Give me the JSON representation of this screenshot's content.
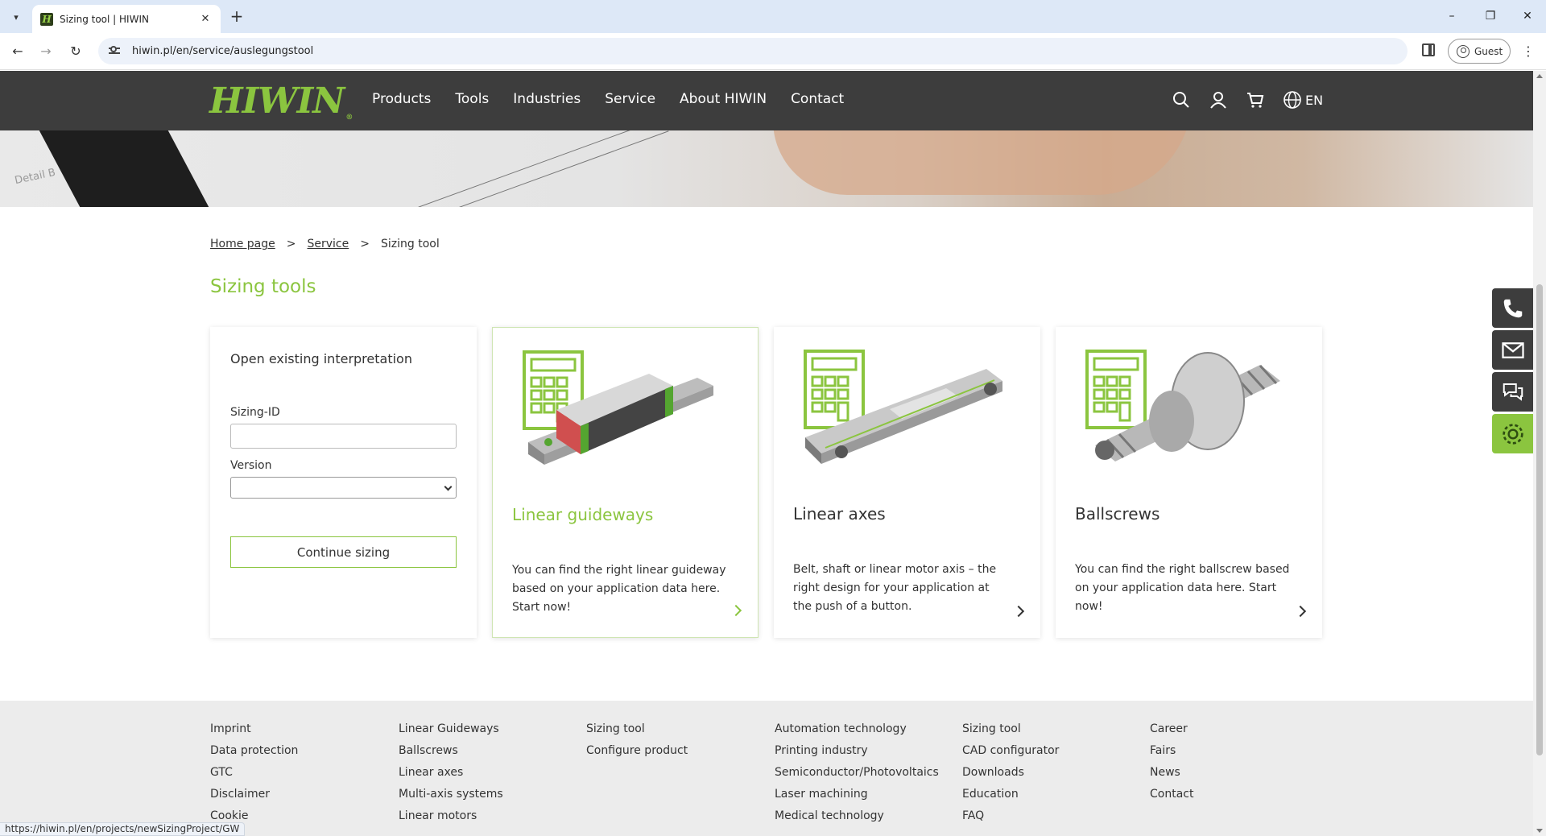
{
  "browser": {
    "tab_title": "Sizing tool | HIWIN",
    "url": "hiwin.pl/en/service/auslegungstool",
    "profile_label": "Guest",
    "status_url": "https://hiwin.pl/en/projects/newSizingProject/GW"
  },
  "header": {
    "logo": "HIWIN",
    "nav": [
      "Products",
      "Tools",
      "Industries",
      "Service",
      "About HIWIN",
      "Contact"
    ],
    "language": "EN"
  },
  "hero": {
    "sketch_text": "Detail B"
  },
  "breadcrumb": {
    "home": "Home page",
    "sep": ">",
    "service": "Service",
    "current": "Sizing tool"
  },
  "page_title": "Sizing tools",
  "open_form": {
    "title": "Open existing interpretation",
    "sizing_id_label": "Sizing-ID",
    "sizing_id_value": "",
    "version_label": "Version",
    "version_value": "",
    "button": "Continue sizing"
  },
  "cards": [
    {
      "title": "Linear guideways",
      "desc": "You can find the right linear guideway based on your application data here. Start now!"
    },
    {
      "title": "Linear axes",
      "desc": "Belt, shaft or linear motor axis – the right design for your application at the push of a button."
    },
    {
      "title": "Ballscrews",
      "desc": "You can find the right ballscrew based on your application data here. Start now!"
    }
  ],
  "footer": {
    "col1": [
      "Imprint",
      "Data protection",
      "GTC",
      "Disclaimer",
      "Cookie"
    ],
    "col2": [
      "Linear Guideways",
      "Ballscrews",
      "Linear axes",
      "Multi-axis systems",
      "Linear motors"
    ],
    "col3": [
      "Sizing tool",
      "Configure product"
    ],
    "col4": [
      "Automation technology",
      "Printing industry",
      "Semiconductor/Photovoltaics",
      "Laser machining",
      "Medical technology"
    ],
    "col5": [
      "Sizing tool",
      "CAD configurator",
      "Downloads",
      "Education",
      "FAQ"
    ],
    "col6": [
      "Career",
      "Fairs",
      "News",
      "Contact"
    ]
  },
  "colors": {
    "brand_green": "#8bc53f",
    "header_bg": "#3d3d3d"
  }
}
